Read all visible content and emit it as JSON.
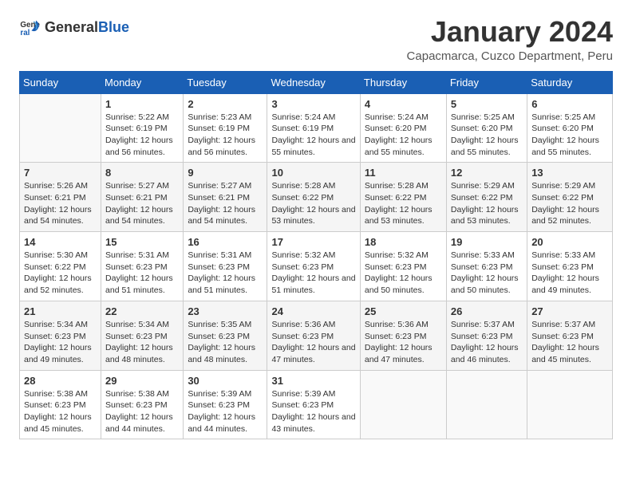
{
  "logo": {
    "general": "General",
    "blue": "Blue"
  },
  "title": "January 2024",
  "subtitle": "Capacmarca, Cuzco Department, Peru",
  "headers": [
    "Sunday",
    "Monday",
    "Tuesday",
    "Wednesday",
    "Thursday",
    "Friday",
    "Saturday"
  ],
  "weeks": [
    [
      {
        "day": "",
        "sunrise": "",
        "sunset": "",
        "daylight": ""
      },
      {
        "day": "1",
        "sunrise": "Sunrise: 5:22 AM",
        "sunset": "Sunset: 6:19 PM",
        "daylight": "Daylight: 12 hours and 56 minutes."
      },
      {
        "day": "2",
        "sunrise": "Sunrise: 5:23 AM",
        "sunset": "Sunset: 6:19 PM",
        "daylight": "Daylight: 12 hours and 56 minutes."
      },
      {
        "day": "3",
        "sunrise": "Sunrise: 5:24 AM",
        "sunset": "Sunset: 6:19 PM",
        "daylight": "Daylight: 12 hours and 55 minutes."
      },
      {
        "day": "4",
        "sunrise": "Sunrise: 5:24 AM",
        "sunset": "Sunset: 6:20 PM",
        "daylight": "Daylight: 12 hours and 55 minutes."
      },
      {
        "day": "5",
        "sunrise": "Sunrise: 5:25 AM",
        "sunset": "Sunset: 6:20 PM",
        "daylight": "Daylight: 12 hours and 55 minutes."
      },
      {
        "day": "6",
        "sunrise": "Sunrise: 5:25 AM",
        "sunset": "Sunset: 6:20 PM",
        "daylight": "Daylight: 12 hours and 55 minutes."
      }
    ],
    [
      {
        "day": "7",
        "sunrise": "Sunrise: 5:26 AM",
        "sunset": "Sunset: 6:21 PM",
        "daylight": "Daylight: 12 hours and 54 minutes."
      },
      {
        "day": "8",
        "sunrise": "Sunrise: 5:27 AM",
        "sunset": "Sunset: 6:21 PM",
        "daylight": "Daylight: 12 hours and 54 minutes."
      },
      {
        "day": "9",
        "sunrise": "Sunrise: 5:27 AM",
        "sunset": "Sunset: 6:21 PM",
        "daylight": "Daylight: 12 hours and 54 minutes."
      },
      {
        "day": "10",
        "sunrise": "Sunrise: 5:28 AM",
        "sunset": "Sunset: 6:22 PM",
        "daylight": "Daylight: 12 hours and 53 minutes."
      },
      {
        "day": "11",
        "sunrise": "Sunrise: 5:28 AM",
        "sunset": "Sunset: 6:22 PM",
        "daylight": "Daylight: 12 hours and 53 minutes."
      },
      {
        "day": "12",
        "sunrise": "Sunrise: 5:29 AM",
        "sunset": "Sunset: 6:22 PM",
        "daylight": "Daylight: 12 hours and 53 minutes."
      },
      {
        "day": "13",
        "sunrise": "Sunrise: 5:29 AM",
        "sunset": "Sunset: 6:22 PM",
        "daylight": "Daylight: 12 hours and 52 minutes."
      }
    ],
    [
      {
        "day": "14",
        "sunrise": "Sunrise: 5:30 AM",
        "sunset": "Sunset: 6:22 PM",
        "daylight": "Daylight: 12 hours and 52 minutes."
      },
      {
        "day": "15",
        "sunrise": "Sunrise: 5:31 AM",
        "sunset": "Sunset: 6:23 PM",
        "daylight": "Daylight: 12 hours and 51 minutes."
      },
      {
        "day": "16",
        "sunrise": "Sunrise: 5:31 AM",
        "sunset": "Sunset: 6:23 PM",
        "daylight": "Daylight: 12 hours and 51 minutes."
      },
      {
        "day": "17",
        "sunrise": "Sunrise: 5:32 AM",
        "sunset": "Sunset: 6:23 PM",
        "daylight": "Daylight: 12 hours and 51 minutes."
      },
      {
        "day": "18",
        "sunrise": "Sunrise: 5:32 AM",
        "sunset": "Sunset: 6:23 PM",
        "daylight": "Daylight: 12 hours and 50 minutes."
      },
      {
        "day": "19",
        "sunrise": "Sunrise: 5:33 AM",
        "sunset": "Sunset: 6:23 PM",
        "daylight": "Daylight: 12 hours and 50 minutes."
      },
      {
        "day": "20",
        "sunrise": "Sunrise: 5:33 AM",
        "sunset": "Sunset: 6:23 PM",
        "daylight": "Daylight: 12 hours and 49 minutes."
      }
    ],
    [
      {
        "day": "21",
        "sunrise": "Sunrise: 5:34 AM",
        "sunset": "Sunset: 6:23 PM",
        "daylight": "Daylight: 12 hours and 49 minutes."
      },
      {
        "day": "22",
        "sunrise": "Sunrise: 5:34 AM",
        "sunset": "Sunset: 6:23 PM",
        "daylight": "Daylight: 12 hours and 48 minutes."
      },
      {
        "day": "23",
        "sunrise": "Sunrise: 5:35 AM",
        "sunset": "Sunset: 6:23 PM",
        "daylight": "Daylight: 12 hours and 48 minutes."
      },
      {
        "day": "24",
        "sunrise": "Sunrise: 5:36 AM",
        "sunset": "Sunset: 6:23 PM",
        "daylight": "Daylight: 12 hours and 47 minutes."
      },
      {
        "day": "25",
        "sunrise": "Sunrise: 5:36 AM",
        "sunset": "Sunset: 6:23 PM",
        "daylight": "Daylight: 12 hours and 47 minutes."
      },
      {
        "day": "26",
        "sunrise": "Sunrise: 5:37 AM",
        "sunset": "Sunset: 6:23 PM",
        "daylight": "Daylight: 12 hours and 46 minutes."
      },
      {
        "day": "27",
        "sunrise": "Sunrise: 5:37 AM",
        "sunset": "Sunset: 6:23 PM",
        "daylight": "Daylight: 12 hours and 45 minutes."
      }
    ],
    [
      {
        "day": "28",
        "sunrise": "Sunrise: 5:38 AM",
        "sunset": "Sunset: 6:23 PM",
        "daylight": "Daylight: 12 hours and 45 minutes."
      },
      {
        "day": "29",
        "sunrise": "Sunrise: 5:38 AM",
        "sunset": "Sunset: 6:23 PM",
        "daylight": "Daylight: 12 hours and 44 minutes."
      },
      {
        "day": "30",
        "sunrise": "Sunrise: 5:39 AM",
        "sunset": "Sunset: 6:23 PM",
        "daylight": "Daylight: 12 hours and 44 minutes."
      },
      {
        "day": "31",
        "sunrise": "Sunrise: 5:39 AM",
        "sunset": "Sunset: 6:23 PM",
        "daylight": "Daylight: 12 hours and 43 minutes."
      },
      {
        "day": "",
        "sunrise": "",
        "sunset": "",
        "daylight": ""
      },
      {
        "day": "",
        "sunrise": "",
        "sunset": "",
        "daylight": ""
      },
      {
        "day": "",
        "sunrise": "",
        "sunset": "",
        "daylight": ""
      }
    ]
  ]
}
